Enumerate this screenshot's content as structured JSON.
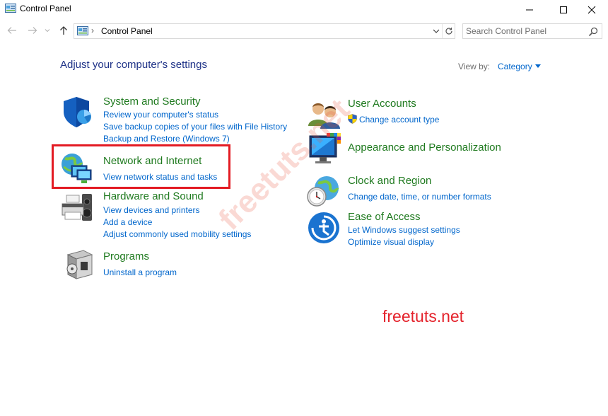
{
  "window": {
    "title": "Control Panel"
  },
  "address": {
    "separator": "›",
    "path": "Control Panel"
  },
  "search": {
    "placeholder": "Search Control Panel"
  },
  "header": {
    "title": "Adjust your computer's settings",
    "view_by_label": "View by:",
    "view_by_value": "Category"
  },
  "categories_left": [
    {
      "title": "System and Security",
      "icon": "shield-icon",
      "links": [
        "Review your computer's status",
        "Save backup copies of your files with File History",
        "Backup and Restore (Windows 7)"
      ]
    },
    {
      "title": "Network and Internet",
      "icon": "network-globe-icon",
      "links": [
        "View network status and tasks"
      ]
    },
    {
      "title": "Hardware and Sound",
      "icon": "printer-speaker-icon",
      "links": [
        "View devices and printers",
        "Add a device",
        "Adjust commonly used mobility settings"
      ]
    },
    {
      "title": "Programs",
      "icon": "programs-box-icon",
      "links": [
        "Uninstall a program"
      ]
    }
  ],
  "categories_right": [
    {
      "title": "User Accounts",
      "icon": "users-icon",
      "links": [
        "Change account type"
      ]
    },
    {
      "title": "Appearance and Personalization",
      "icon": "monitor-palette-icon",
      "links": []
    },
    {
      "title": "Clock and Region",
      "icon": "clock-globe-icon",
      "links": [
        "Change date, time, or number formats"
      ]
    },
    {
      "title": "Ease of Access",
      "icon": "ease-of-access-icon",
      "links": [
        "Let Windows suggest settings",
        "Optimize visual display"
      ]
    }
  ],
  "watermark": {
    "diagonal": "freetuts.net",
    "text": "freetuts.net"
  },
  "colors": {
    "title_blue": "#1e3287",
    "category_green": "#1f7a1f",
    "link_blue": "#0066cc",
    "highlight_red": "#e31b23",
    "watermark_red": "#e4222b"
  }
}
